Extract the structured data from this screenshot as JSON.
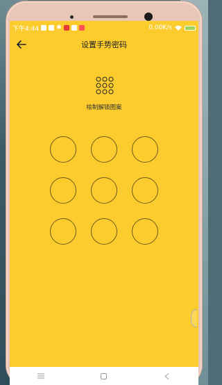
{
  "status": {
    "time": "下午4:44",
    "network_speed": "0.00K/s",
    "notification_colors": [
      "#ffffff",
      "#ffffff",
      "#e53935",
      "#ffffff",
      "#ff5252"
    ]
  },
  "header": {
    "title": "设置手势密码",
    "back_icon": "arrow-left-icon"
  },
  "main": {
    "pattern_icon": "pattern-grid-icon",
    "hint": "绘制解锁图案",
    "dots": [
      "dot-1",
      "dot-2",
      "dot-3",
      "dot-4",
      "dot-5",
      "dot-6",
      "dot-7",
      "dot-8",
      "dot-9"
    ]
  },
  "navbar": {
    "menu_icon": "menu-icon",
    "home_icon": "home-icon",
    "back_icon": "back-icon"
  },
  "colors": {
    "screen_bg": "#fccc2e",
    "circle_stroke": "#6e5a1c",
    "frame": "#e9c7b8"
  }
}
